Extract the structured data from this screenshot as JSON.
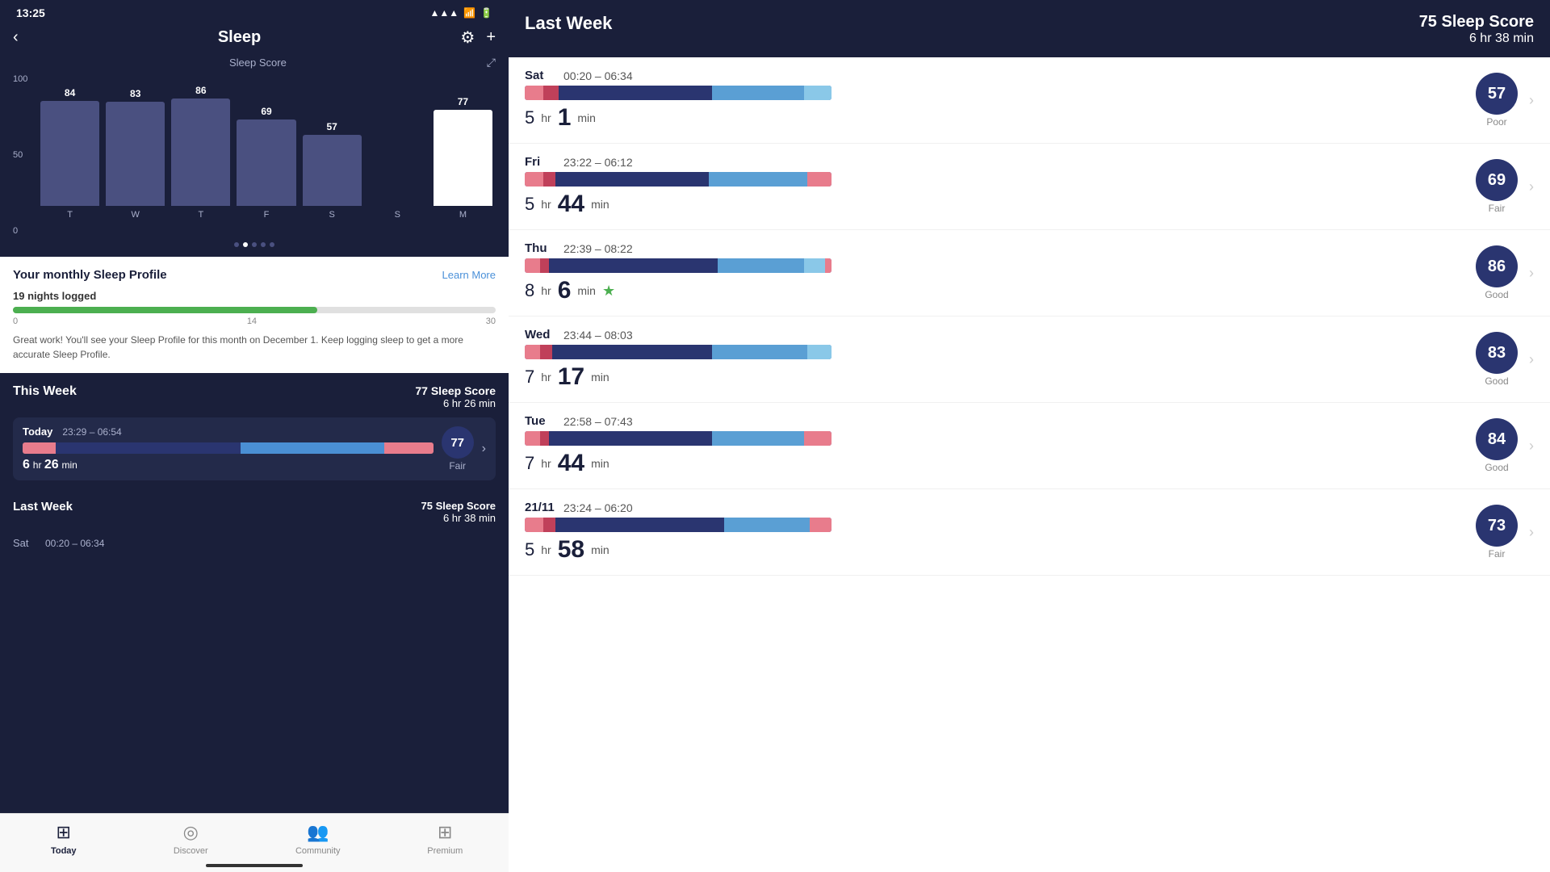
{
  "app": {
    "title": "Sleep",
    "status_time": "13:25"
  },
  "chart": {
    "title": "Sleep Score",
    "y_labels": [
      "100",
      "50",
      "0"
    ],
    "bars": [
      {
        "day": "T",
        "score": 84,
        "height_pct": 84,
        "highlighted": false
      },
      {
        "day": "W",
        "score": 83,
        "height_pct": 83,
        "highlighted": false
      },
      {
        "day": "T",
        "score": 86,
        "height_pct": 86,
        "highlighted": false
      },
      {
        "day": "F",
        "score": 69,
        "height_pct": 69,
        "highlighted": false
      },
      {
        "day": "S",
        "score": 57,
        "height_pct": 57,
        "highlighted": false
      },
      {
        "day": "S",
        "score": null,
        "height_pct": 0,
        "highlighted": false
      },
      {
        "day": "M",
        "score": 77,
        "height_pct": 77,
        "highlighted": true
      }
    ]
  },
  "sleep_profile": {
    "title": "Your monthly Sleep Profile",
    "learn_more": "Learn More",
    "nights_logged_label": "19 nights logged",
    "progress_pct": 63,
    "progress_label_0": "0",
    "progress_label_14": "14",
    "progress_label_30": "30",
    "description": "Great work! You'll see your Sleep Profile for this month on December 1. Keep logging sleep to get a more accurate Sleep Profile."
  },
  "this_week": {
    "title": "This Week",
    "score_line1": "77 Sleep Score",
    "score_line2": "6 hr 26 min",
    "today_label": "Today",
    "today_time": "23:29 – 06:54",
    "today_score": "77",
    "today_hrs": "6",
    "today_min": "26",
    "today_min_label": "min",
    "today_quality": "Fair"
  },
  "last_week": {
    "title": "Last Week",
    "score_line1": "75 Sleep Score",
    "score_line2": "6 hr 38 min",
    "right_panel_score_num": "75 Sleep Score",
    "right_panel_score_time": "6 hr 38 min",
    "entries": [
      {
        "day": "Sat",
        "time_range": "00:20 – 06:34",
        "hrs": "5",
        "min": "1",
        "score": "57",
        "quality": "Poor",
        "has_star": false
      },
      {
        "day": "Fri",
        "time_range": "23:22 – 06:12",
        "hrs": "5",
        "min": "44",
        "score": "69",
        "quality": "Fair",
        "has_star": false
      },
      {
        "day": "Thu",
        "time_range": "22:39 – 08:22",
        "hrs": "8",
        "min": "6",
        "score": "86",
        "quality": "Good",
        "has_star": true
      },
      {
        "day": "Wed",
        "time_range": "23:44 – 08:03",
        "hrs": "7",
        "min": "17",
        "score": "83",
        "quality": "Good",
        "has_star": false
      },
      {
        "day": "Tue",
        "time_range": "22:58 – 07:43",
        "hrs": "7",
        "min": "44",
        "score": "84",
        "quality": "Good",
        "has_star": false
      },
      {
        "day": "21/11",
        "time_range": "23:24 – 06:20",
        "hrs": "5",
        "min": "58",
        "score": "73",
        "quality": "Fair",
        "has_star": false
      }
    ]
  },
  "bottom_nav": {
    "items": [
      {
        "label": "Today",
        "active": true
      },
      {
        "label": "Discover",
        "active": false
      },
      {
        "label": "Community",
        "active": false
      },
      {
        "label": "Premium",
        "active": false
      }
    ]
  }
}
